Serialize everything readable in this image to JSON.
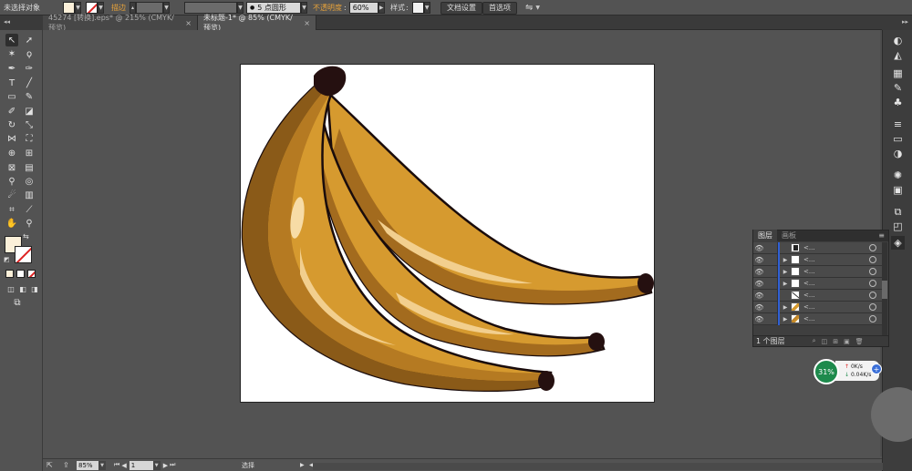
{
  "control_bar": {
    "selection_status": "未选择对象",
    "stroke_label": "描边",
    "brush_value": "5 点圆形",
    "opacity_label": "不透明度",
    "opacity_value": "60%",
    "style_label": "样式",
    "doc_setup_button": "文档设置",
    "prefs_button": "首选项"
  },
  "tabs": [
    {
      "label": "45274 [转换].eps* @ 215% (CMYK/预览)",
      "active": false
    },
    {
      "label": "未标题-1* @ 85% (CMYK/预览)",
      "active": true
    }
  ],
  "layers_panel": {
    "tab_layers": "图层",
    "tab_artboards": "画板",
    "rows": [
      {
        "name": "<...",
        "thumb": "dark"
      },
      {
        "name": "<...",
        "thumb": "white"
      },
      {
        "name": "<...",
        "thumb": "white"
      },
      {
        "name": "<...",
        "thumb": "white"
      },
      {
        "name": "<...",
        "thumb": "line"
      },
      {
        "name": "<...",
        "thumb": "banana"
      },
      {
        "name": "<...",
        "thumb": "banana"
      }
    ],
    "footer_count": "1 个图层"
  },
  "net_widget": {
    "percent": "31%",
    "up": "0K/s",
    "down": "0.04K/s"
  },
  "status_bar": {
    "zoom": "85%",
    "artboard_number": "1",
    "tool_name": "选择"
  },
  "colors": {
    "fill_swatch": "#fbf0d9",
    "banana_main": "#d69a2f",
    "banana_mid": "#b57a22",
    "banana_dark": "#8a5a18",
    "banana_highlight": "#f2cf8e",
    "stem": "#251010",
    "layer_color": "#2f5fd5",
    "widget_green": "#1d8a4c"
  }
}
